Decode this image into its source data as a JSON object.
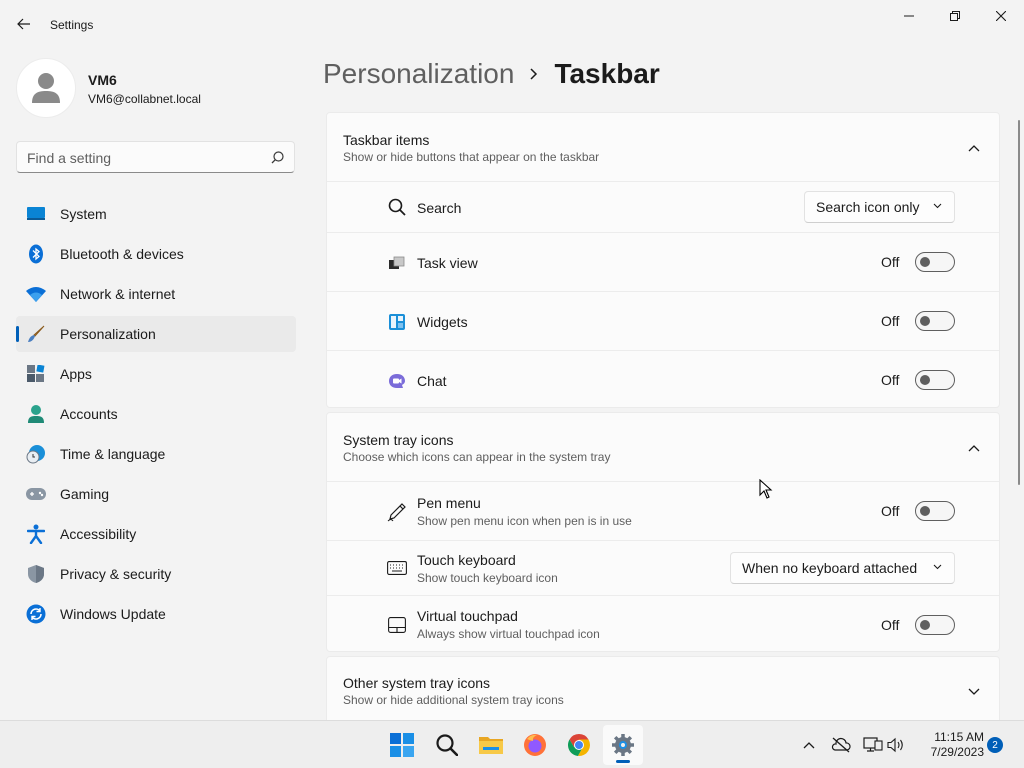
{
  "window": {
    "title": "Settings"
  },
  "user": {
    "name": "VM6",
    "email": "VM6@collabnet.local"
  },
  "search": {
    "placeholder": "Find a setting"
  },
  "sidebar": {
    "items": [
      {
        "label": "System",
        "icon": "system-icon",
        "selected": false
      },
      {
        "label": "Bluetooth & devices",
        "icon": "bluetooth-icon",
        "selected": false
      },
      {
        "label": "Network & internet",
        "icon": "wifi-icon",
        "selected": false
      },
      {
        "label": "Personalization",
        "icon": "paintbrush-icon",
        "selected": true
      },
      {
        "label": "Apps",
        "icon": "apps-icon",
        "selected": false
      },
      {
        "label": "Accounts",
        "icon": "person-icon",
        "selected": false
      },
      {
        "label": "Time & language",
        "icon": "globe-clock-icon",
        "selected": false
      },
      {
        "label": "Gaming",
        "icon": "gamepad-icon",
        "selected": false
      },
      {
        "label": "Accessibility",
        "icon": "accessibility-icon",
        "selected": false
      },
      {
        "label": "Privacy & security",
        "icon": "shield-icon",
        "selected": false
      },
      {
        "label": "Windows Update",
        "icon": "update-icon",
        "selected": false
      }
    ]
  },
  "breadcrumb": {
    "parent": "Personalization",
    "current": "Taskbar"
  },
  "sections": {
    "taskbar_items": {
      "title": "Taskbar items",
      "subtitle": "Show or hide buttons that appear on the taskbar",
      "rows": {
        "search": {
          "label": "Search",
          "value": "Search icon only"
        },
        "task_view": {
          "label": "Task view",
          "state": "Off"
        },
        "widgets": {
          "label": "Widgets",
          "state": "Off"
        },
        "chat": {
          "label": "Chat",
          "state": "Off"
        }
      }
    },
    "system_tray": {
      "title": "System tray icons",
      "subtitle": "Choose which icons can appear in the system tray",
      "rows": {
        "pen_menu": {
          "label": "Pen menu",
          "description": "Show pen menu icon when pen is in use",
          "state": "Off"
        },
        "touch_keyboard": {
          "label": "Touch keyboard",
          "description": "Show touch keyboard icon",
          "value": "When no keyboard attached"
        },
        "virtual_touchpad": {
          "label": "Virtual touchpad",
          "description": "Always show virtual touchpad icon",
          "state": "Off"
        }
      }
    },
    "other_tray": {
      "title": "Other system tray icons",
      "subtitle": "Show or hide additional system tray icons"
    }
  },
  "taskbar": {
    "clock_time": "11:15 AM",
    "clock_date": "7/29/2023",
    "notification_count": "2",
    "pinned": [
      "start-icon",
      "search-icon",
      "file-explorer-icon",
      "firefox-icon",
      "chrome-icon",
      "settings-icon"
    ]
  },
  "colors": {
    "accent": "#005fb8",
    "background": "#f3f3f3",
    "card": "#fbfbfb"
  }
}
